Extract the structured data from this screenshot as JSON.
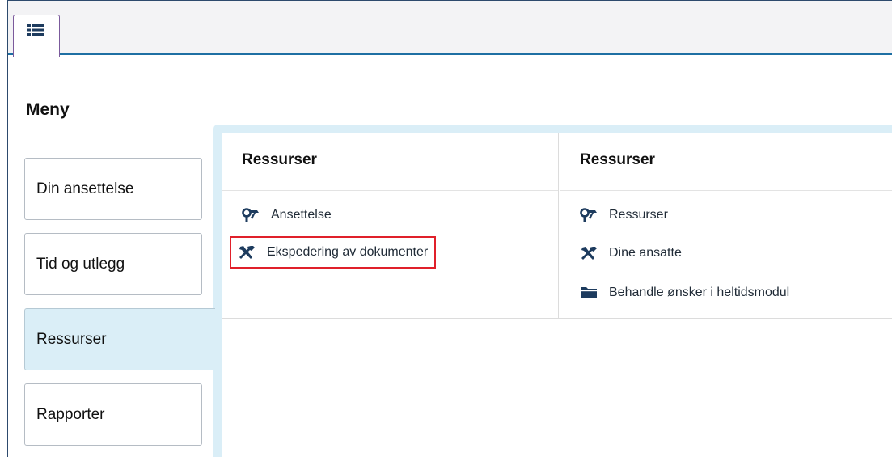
{
  "tabbar": {
    "home_tab_icon": "list-icon"
  },
  "menu": {
    "title": "Meny"
  },
  "sidebar": {
    "items": [
      {
        "label": "Din ansettelse"
      },
      {
        "label": "Tid og utlegg"
      },
      {
        "label": "Ressurser",
        "active": true
      },
      {
        "label": "Rapporter"
      }
    ]
  },
  "columns": [
    {
      "heading": "Ressurser",
      "links": [
        {
          "label": "Ansettelse",
          "icon": "hammer-wrench-icon"
        },
        {
          "label": "Ekspedering av dokumenter",
          "icon": "crossed-tools-icon",
          "highlighted": true
        }
      ]
    },
    {
      "heading": "Ressurser",
      "links": [
        {
          "label": "Ressurser",
          "icon": "hammer-wrench-icon"
        },
        {
          "label": "Dine ansatte",
          "icon": "crossed-tools-icon"
        },
        {
          "label": "Behandle ønsker i heltidsmodul",
          "icon": "folder-icon"
        }
      ]
    }
  ],
  "colors": {
    "accent": "#1e6fa3",
    "active_bg": "#daeef7",
    "icon": "#1d3b5e",
    "highlight_border": "#e0202a"
  }
}
